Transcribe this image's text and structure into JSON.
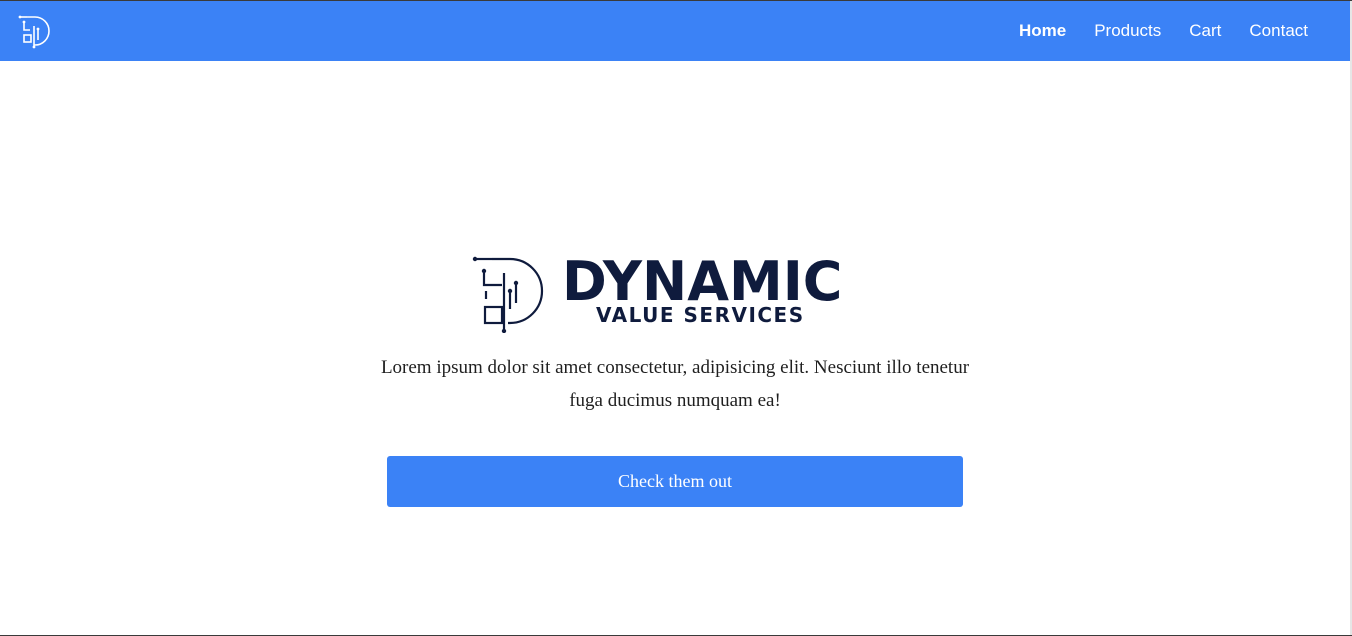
{
  "navbar": {
    "logo_icon": "dv-circuit-logo-icon",
    "links": [
      {
        "label": "Home",
        "active": true
      },
      {
        "label": "Products",
        "active": false
      },
      {
        "label": "Cart",
        "active": false
      },
      {
        "label": "Contact",
        "active": false
      }
    ]
  },
  "hero": {
    "brand_name": "DYNAMIC",
    "brand_sub": "VALUE SERVICES",
    "intro_text": "Lorem ipsum dolor sit amet consectetur, adipisicing elit. Nesciunt illo tenetur fuga ducimus numquam ea!",
    "cta_label": "Check them out"
  },
  "colors": {
    "primary": "#3b82f6",
    "brand_dark": "#0f1b3d",
    "text": "#1f1f1f",
    "background": "#ffffff"
  }
}
